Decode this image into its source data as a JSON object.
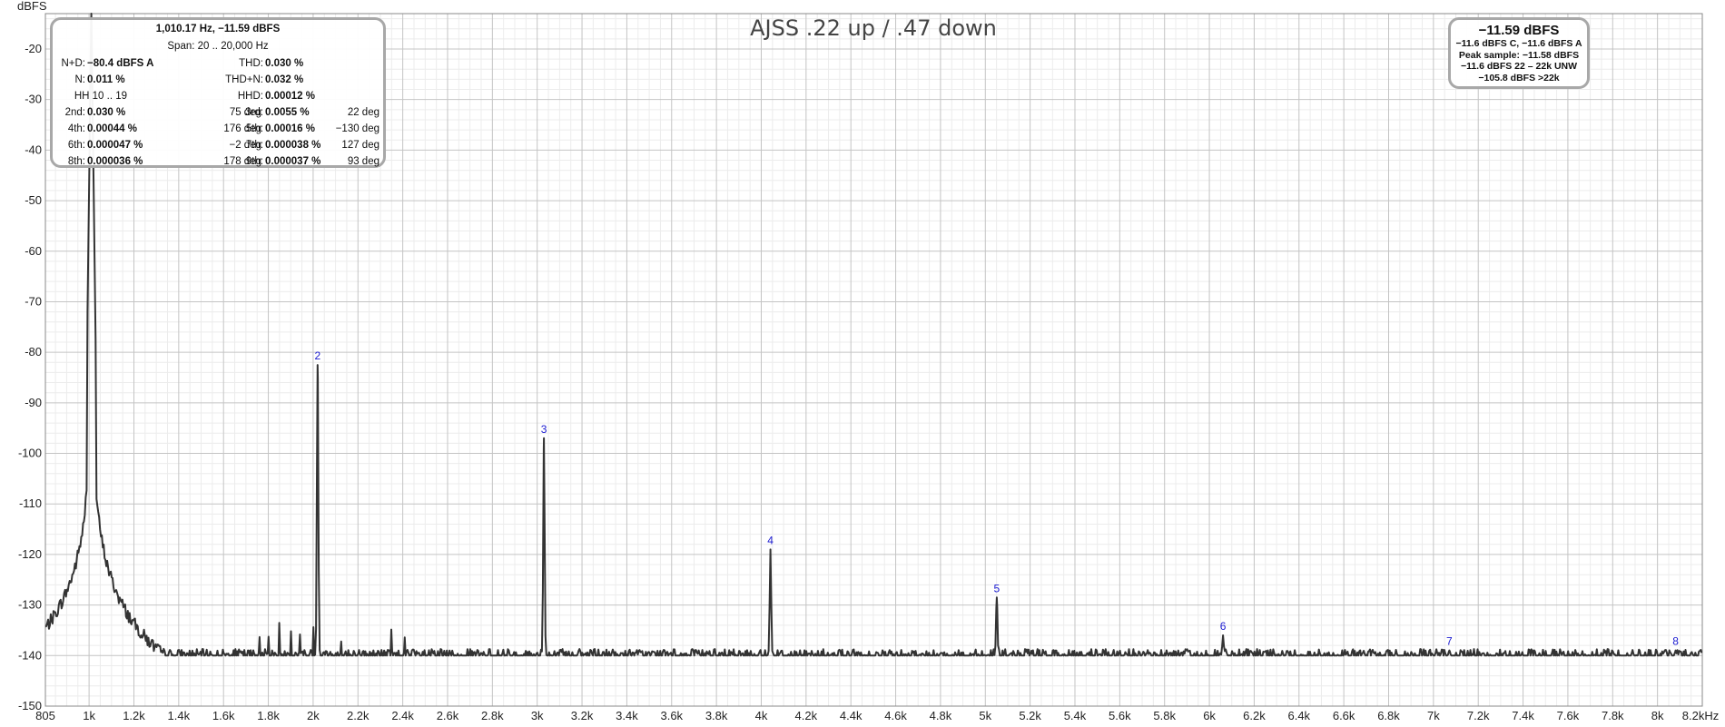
{
  "chart_data": {
    "type": "line",
    "title": "AJSS .22 up / .47 down",
    "ylabel": "dBFS",
    "xlabel": "",
    "x_unit_label": "8.2kHz",
    "xlim": [
      805,
      8200
    ],
    "ylim": [
      -150,
      -13
    ],
    "y_ticks": [
      -20,
      -30,
      -40,
      -50,
      -60,
      -70,
      -80,
      -90,
      -100,
      -110,
      -120,
      -130,
      -140,
      -150
    ],
    "x_ticks": [
      {
        "v": 805,
        "label": "805"
      },
      {
        "v": 1000,
        "label": "1k"
      },
      {
        "v": 1200,
        "label": "1.2k"
      },
      {
        "v": 1400,
        "label": "1.4k"
      },
      {
        "v": 1600,
        "label": "1.6k"
      },
      {
        "v": 1800,
        "label": "1.8k"
      },
      {
        "v": 2000,
        "label": "2k"
      },
      {
        "v": 2200,
        "label": "2.2k"
      },
      {
        "v": 2400,
        "label": "2.4k"
      },
      {
        "v": 2600,
        "label": "2.6k"
      },
      {
        "v": 2800,
        "label": "2.8k"
      },
      {
        "v": 3000,
        "label": "3k"
      },
      {
        "v": 3200,
        "label": "3.2k"
      },
      {
        "v": 3400,
        "label": "3.4k"
      },
      {
        "v": 3600,
        "label": "3.6k"
      },
      {
        "v": 3800,
        "label": "3.8k"
      },
      {
        "v": 4000,
        "label": "4k"
      },
      {
        "v": 4200,
        "label": "4.2k"
      },
      {
        "v": 4400,
        "label": "4.4k"
      },
      {
        "v": 4600,
        "label": "4.6k"
      },
      {
        "v": 4800,
        "label": "4.8k"
      },
      {
        "v": 5000,
        "label": "5k"
      },
      {
        "v": 5200,
        "label": "5.2k"
      },
      {
        "v": 5400,
        "label": "5.4k"
      },
      {
        "v": 5600,
        "label": "5.6k"
      },
      {
        "v": 5800,
        "label": "5.8k"
      },
      {
        "v": 6000,
        "label": "6k"
      },
      {
        "v": 6200,
        "label": "6.2k"
      },
      {
        "v": 6400,
        "label": "6.4k"
      },
      {
        "v": 6600,
        "label": "6.6k"
      },
      {
        "v": 6800,
        "label": "6.8k"
      },
      {
        "v": 7000,
        "label": "7k"
      },
      {
        "v": 7200,
        "label": "7.2k"
      },
      {
        "v": 7400,
        "label": "7.4k"
      },
      {
        "v": 7600,
        "label": "7.6k"
      },
      {
        "v": 7800,
        "label": "7.8k"
      },
      {
        "v": 8000,
        "label": "8k"
      }
    ],
    "grid": true,
    "noise_floor_db": -140,
    "fundamental": {
      "freq_hz": 1010.17,
      "level_db": -11.59
    },
    "harmonics": [
      {
        "label": "2",
        "freq_hz": 2020,
        "level_db": -82.5
      },
      {
        "label": "3",
        "freq_hz": 3030,
        "level_db": -97
      },
      {
        "label": "4",
        "freq_hz": 4041,
        "level_db": -119
      },
      {
        "label": "5",
        "freq_hz": 5051,
        "level_db": -128.5
      },
      {
        "label": "6",
        "freq_hz": 6061,
        "level_db": -136
      },
      {
        "label": "7",
        "freq_hz": 7071,
        "level_db": -139
      },
      {
        "label": "8",
        "freq_hz": 8081,
        "level_db": -139
      }
    ],
    "line_color": "#333333",
    "harmonic_label_color": "#1a1ad0"
  },
  "info_box": {
    "header1": "1,010.17 Hz, −11.59 dBFS",
    "header2": "Span: 20 .. 20,000 Hz",
    "hh_range": "HH 10 .. 19",
    "n_plus_d": {
      "label": "N+D:",
      "value": "−80.4 dBFS A"
    },
    "thd": {
      "label": "THD:",
      "value": "0.030 %"
    },
    "n": {
      "label": "N:",
      "value": "0.011 %"
    },
    "thd_n": {
      "label": "THD+N:",
      "value": "0.032 %"
    },
    "hhd": {
      "label": "HHD:",
      "value": "0.00012 %"
    },
    "rows": [
      {
        "l1": "2nd:",
        "v1": "0.030 %",
        "d1": "75 deg",
        "l2": "3rd:",
        "v2": "0.0055 %",
        "d2": "22 deg"
      },
      {
        "l1": "4th:",
        "v1": "0.00044 %",
        "d1": "176 deg",
        "l2": "5th:",
        "v2": "0.00016 %",
        "d2": "−130 deg"
      },
      {
        "l1": "6th:",
        "v1": "0.000047 %",
        "d1": "−2 deg",
        "l2": "7th:",
        "v2": "0.000038 %",
        "d2": "127 deg"
      },
      {
        "l1": "8th:",
        "v1": "0.000036 %",
        "d1": "178 deg",
        "l2": "9th:",
        "v2": "0.000037 %",
        "d2": "93 deg"
      }
    ]
  },
  "level_box": {
    "main": "−11.59 dBFS",
    "lines": [
      "−11.6 dBFS C, −11.6 dBFS A",
      "Peak sample: −11.58 dBFS",
      "−11.6 dBFS 22 – 22k UNW",
      "−105.8 dBFS >22k"
    ]
  }
}
